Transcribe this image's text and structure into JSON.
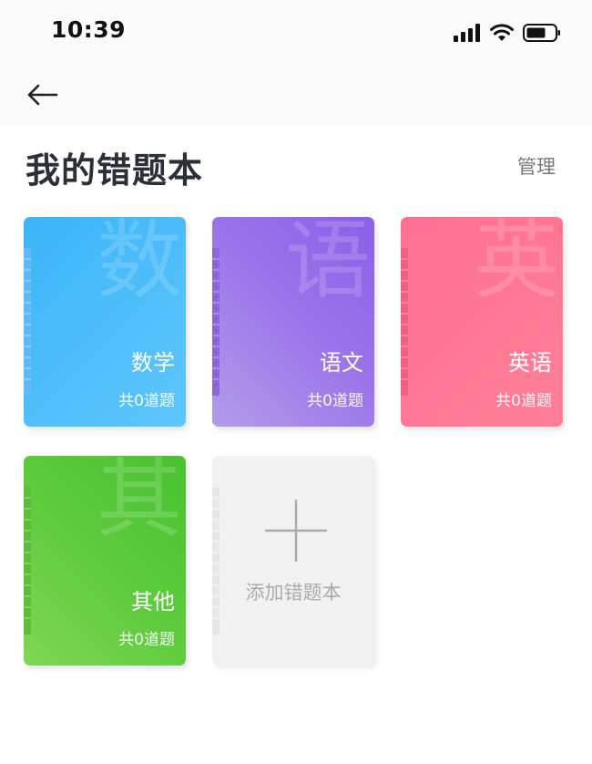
{
  "status_bar": {
    "time": "10:39",
    "icons": [
      "signal-icon",
      "wifi-icon",
      "battery-icon"
    ]
  },
  "nav": {
    "back_icon": "arrow-left-icon"
  },
  "header": {
    "title": "我的错题本",
    "manage_label": "管理"
  },
  "notebooks": [
    {
      "name": "数学",
      "watermark": "数",
      "count_text": "共0道题",
      "spine_color": "#5db9f7"
    },
    {
      "name": "语文",
      "watermark": "语",
      "count_text": "共0道题",
      "spine_color": "#8d66de"
    },
    {
      "name": "英语",
      "watermark": "英",
      "count_text": "共0道题",
      "spine_color": "#f25f83"
    },
    {
      "name": "其他",
      "watermark": "其",
      "count_text": "共0道题",
      "spine_color": "#5bbf3c"
    }
  ],
  "add_notebook": {
    "label": "添加错题本",
    "icon": "plus-icon"
  }
}
